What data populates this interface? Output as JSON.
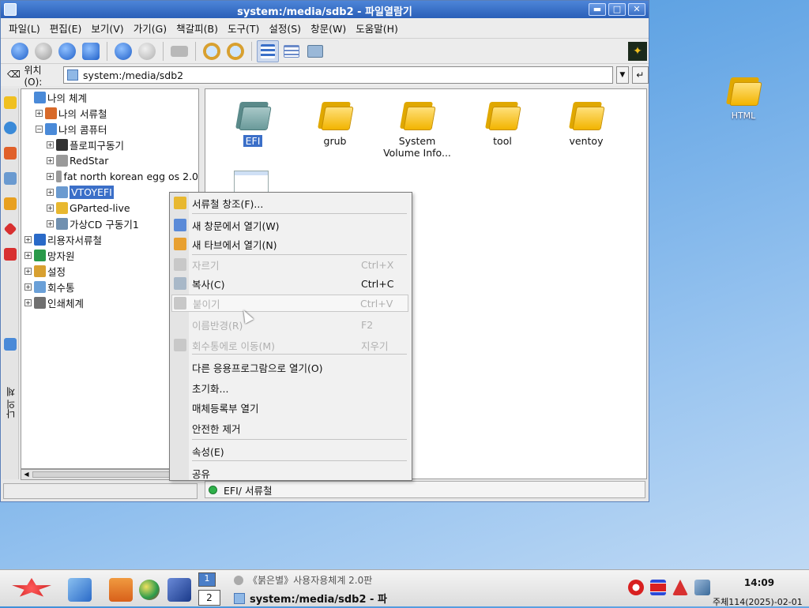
{
  "window": {
    "title": "system:/media/sdb2 - 파일열람기",
    "buttons": [
      "▬",
      "□",
      "✕"
    ]
  },
  "menubar": [
    "파일(L)",
    "편집(E)",
    "보기(V)",
    "가기(G)",
    "책갈피(B)",
    "도구(T)",
    "설정(S)",
    "창문(W)",
    "도움말(H)"
  ],
  "location": {
    "label": "위치(O):",
    "value": "system:/media/sdb2"
  },
  "sidebar": {
    "vertical_label": "나의 체계"
  },
  "tree": [
    {
      "label": "나의 체계",
      "level": 0,
      "exp": "",
      "icon": "computer-icon",
      "color": "#4a8ad8"
    },
    {
      "label": "나의 서류철",
      "level": 1,
      "exp": "+",
      "icon": "documents-icon",
      "color": "#d86a2a"
    },
    {
      "label": "나의 콤퓨터",
      "level": 1,
      "exp": "−",
      "icon": "computer-icon",
      "color": "#4a8ad8"
    },
    {
      "label": "플로피구동기",
      "level": 2,
      "exp": "+",
      "icon": "floppy-icon",
      "color": "#333333"
    },
    {
      "label": "RedStar",
      "level": 2,
      "exp": "+",
      "icon": "harddisk-icon",
      "color": "#9a9a9a"
    },
    {
      "label": "fat north korean egg os 2.0",
      "level": 2,
      "exp": "+",
      "icon": "harddisk-icon",
      "color": "#9a9a9a"
    },
    {
      "label": "VTOYEFI",
      "level": 2,
      "exp": "+",
      "icon": "usb-drive-icon",
      "color": "#6a9ad0",
      "selected": true
    },
    {
      "label": "GParted-live",
      "level": 2,
      "exp": "+",
      "icon": "cdrom-icon",
      "color": "#e8b830"
    },
    {
      "label": "가상CD 구동기1",
      "level": 2,
      "exp": "+",
      "icon": "virtual-cd-icon",
      "color": "#7090b0"
    },
    {
      "label": "리용자서류철",
      "level": 0,
      "exp": "+",
      "icon": "user-folder-icon",
      "color": "#2a6ac8"
    },
    {
      "label": "망자원",
      "level": 0,
      "exp": "+",
      "icon": "network-icon",
      "color": "#2a9a4a"
    },
    {
      "label": "설정",
      "level": 0,
      "exp": "+",
      "icon": "settings-icon",
      "color": "#d8a030"
    },
    {
      "label": "회수통",
      "level": 0,
      "exp": "+",
      "icon": "trash-icon",
      "color": "#6aa0d8"
    },
    {
      "label": "인쇄체계",
      "level": 0,
      "exp": "+",
      "icon": "printer-icon",
      "color": "#707070"
    }
  ],
  "files": [
    {
      "name": "EFI",
      "selected": true,
      "style": "gray"
    },
    {
      "name": "grub"
    },
    {
      "name": "System\nVolume Info..."
    },
    {
      "name": "tool"
    },
    {
      "name": "ventoy"
    }
  ],
  "status": {
    "text": "EFI/  서류철"
  },
  "context_menu": [
    {
      "label": "서류철 창조(F)...",
      "shortcut": "",
      "disabled": false,
      "icon": "new-folder-icon"
    },
    {
      "sep": true
    },
    {
      "label": "새 창문에서 열기(W)",
      "shortcut": "",
      "disabled": false,
      "icon": "new-window-icon"
    },
    {
      "label": "새 타브에서 열기(N)",
      "shortcut": "",
      "disabled": false,
      "icon": "new-tab-icon"
    },
    {
      "sep": true
    },
    {
      "label": "자르기",
      "shortcut": "Ctrl+X",
      "disabled": true,
      "icon": "cut-icon"
    },
    {
      "label": "복사(C)",
      "shortcut": "Ctrl+C",
      "disabled": false,
      "icon": "copy-icon"
    },
    {
      "label": "붙이기",
      "shortcut": "Ctrl+V",
      "disabled": true,
      "icon": "paste-icon",
      "hover": true
    },
    {
      "label": "이름반경(R)",
      "shortcut": "F2",
      "disabled": true,
      "icon": ""
    },
    {
      "label": "회수통에로 이동(M)",
      "shortcut": "지우기",
      "disabled": true,
      "icon": "trash-icon"
    },
    {
      "sep": true
    },
    {
      "label": "다른 응용프로그람으로 열기(O)",
      "shortcut": "",
      "disabled": false,
      "icon": ""
    },
    {
      "label": "초기화...",
      "shortcut": "",
      "disabled": false,
      "icon": ""
    },
    {
      "label": "매체등록부 열기",
      "shortcut": "",
      "disabled": false,
      "icon": ""
    },
    {
      "label": "안전한 제거",
      "shortcut": "",
      "disabled": false,
      "icon": ""
    },
    {
      "sep": true
    },
    {
      "label": "속성(E)",
      "shortcut": "",
      "disabled": false,
      "icon": ""
    },
    {
      "sep": true
    },
    {
      "label": "공유",
      "shortcut": "",
      "disabled": false,
      "icon": ""
    }
  ],
  "desktop": {
    "icon_label": "HTML"
  },
  "taskbar": {
    "desktop_top": "1",
    "desktop_number": "2",
    "task1": "《붉은별》사용자용체계 2.0판",
    "task2": "system:/media/sdb2 - 파",
    "clock": "14:09",
    "date": "주체114(2025)-02-01"
  },
  "colors": {
    "selection": "#3b6fc8",
    "titlebar": "#2a5fb8",
    "folder": "#f2b400"
  }
}
